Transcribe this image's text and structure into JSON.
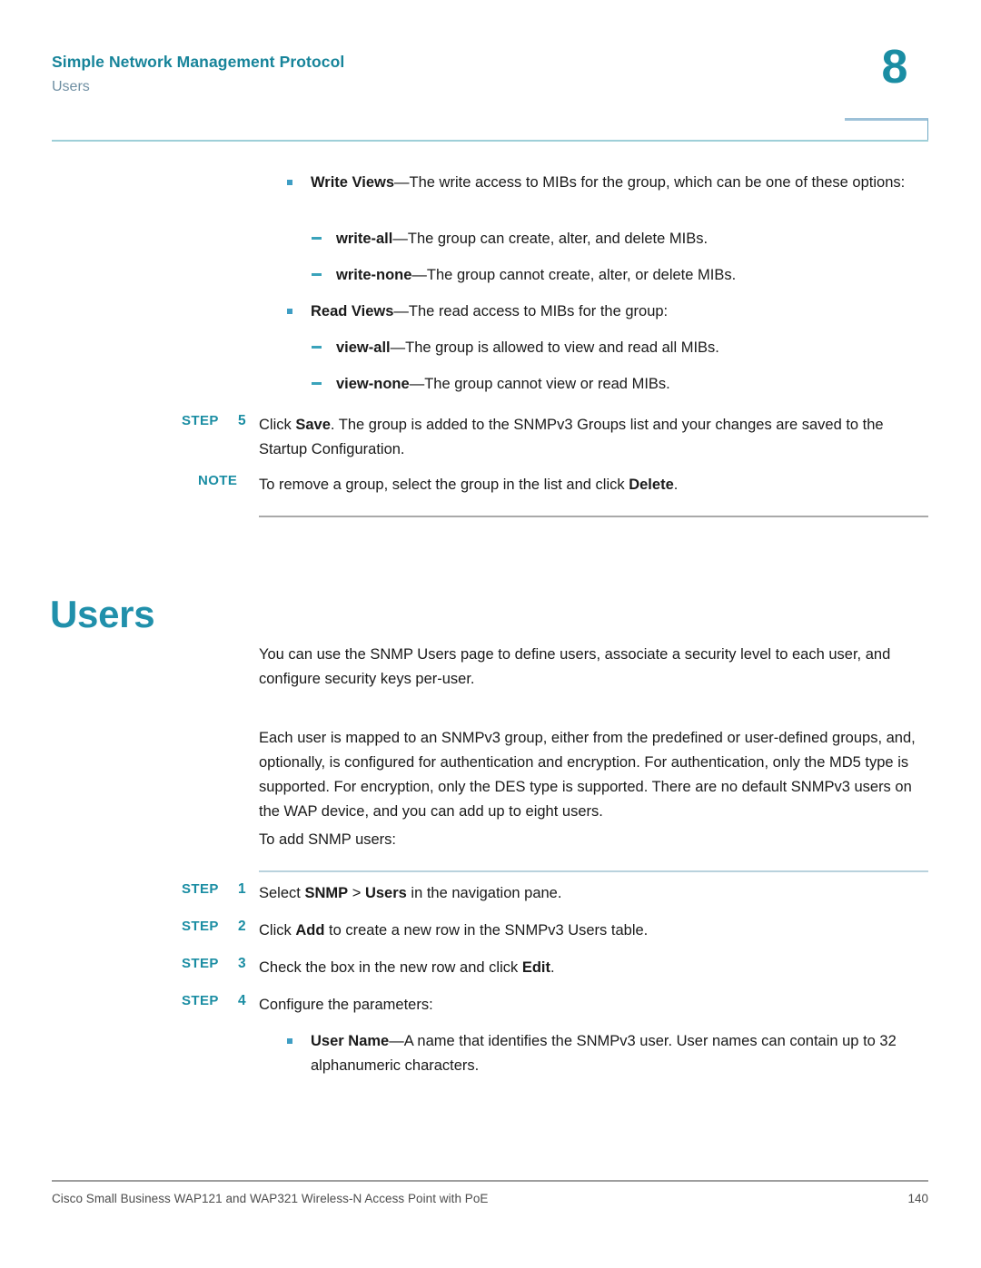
{
  "header": {
    "title": "Simple Network Management Protocol",
    "subtitle": "Users",
    "chapter_number": "8",
    "accent_color": "#17849a",
    "rule_color": "#9ecfd8"
  },
  "body": {
    "bullets_top": [
      {
        "level": 1,
        "bold": "Write Views",
        "rest": "—The write access to MIBs for the group, which can be one of these options:"
      },
      {
        "level": 2,
        "bold": "write-all",
        "rest": "—The group can create, alter, and delete MIBs."
      },
      {
        "level": 2,
        "bold": "write-none",
        "rest": "—The group cannot create, alter, or delete MIBs."
      },
      {
        "level": 1,
        "bold": "Read Views",
        "rest": "—The read access to MIBs for the group:"
      },
      {
        "level": 2,
        "bold": "view-all",
        "rest": "—The group is allowed to view and read all MIBs."
      },
      {
        "level": 2,
        "bold": "view-none",
        "rest": "—The group cannot view or read MIBs."
      }
    ],
    "step5": {
      "label": "STEP",
      "number": "5",
      "text_pre": "Click ",
      "text_bold": "Save",
      "text_post": ". The group is added to the SNMPv3 Groups list and your changes are saved to the Startup Configuration."
    },
    "note": {
      "label": "NOTE",
      "text_pre": "To remove a group, select the group in the list and click ",
      "text_bold": "Delete",
      "text_post": "."
    },
    "section_heading": "Users",
    "paragraphs": [
      "You can use the SNMP Users page to define users, associate a security level to each user, and configure security keys per-user.",
      "Each user is mapped to an SNMPv3 group, either from the predefined or user-defined groups, and, optionally, is configured for authentication and encryption. For authentication, only the MD5 type is supported. For encryption, only the DES type is supported. There are no default SNMPv3 users on the WAP device, and you can add up to eight users.",
      "To add SNMP users:"
    ],
    "steps": [
      {
        "label": "STEP",
        "number": "1",
        "pre": "Select ",
        "bold1": "SNMP",
        "mid": " > ",
        "bold2": "Users",
        "post": " in the navigation pane."
      },
      {
        "label": "STEP",
        "number": "2",
        "pre": "Click ",
        "bold1": "Add",
        "mid": "",
        "bold2": "",
        "post": " to create a new row in the SNMPv3 Users table."
      },
      {
        "label": "STEP",
        "number": "3",
        "pre": "Check the box in the new row and click ",
        "bold1": "Edit",
        "mid": "",
        "bold2": "",
        "post": "."
      },
      {
        "label": "STEP",
        "number": "4",
        "pre": "Configure the parameters:",
        "bold1": "",
        "mid": "",
        "bold2": "",
        "post": ""
      }
    ],
    "bullets_bottom": [
      {
        "level": 1,
        "bold": "User Name",
        "rest": "—A name that identifies the SNMPv3 user. User names can contain up to 32 alphanumeric characters."
      }
    ]
  },
  "footer": {
    "text": "Cisco Small Business WAP121 and WAP321 Wireless-N Access Point with PoE",
    "page_number": "140"
  }
}
